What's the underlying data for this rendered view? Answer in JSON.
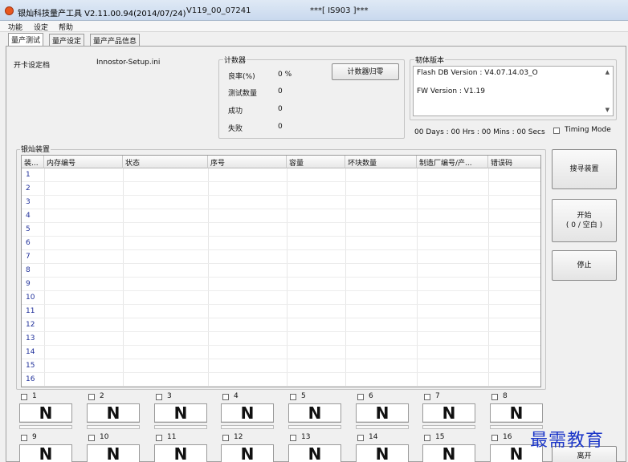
{
  "window": {
    "title": "银灿科技量产工具 V2.11.00.94(2014/07/24)",
    "version_code": "V119_00_07241",
    "model": "***[ IS903 ]***"
  },
  "menu": [
    "功能",
    "设定",
    "帮助"
  ],
  "tabs": [
    "量产测试",
    "量产设定",
    "量产产品信息"
  ],
  "settings_file": {
    "label": "开卡设定档",
    "value": "Innostor-Setup.ini"
  },
  "counter": {
    "title": "计数器",
    "yield_label": "良率(%)",
    "yield_value": "0 %",
    "tested_label": "测试数量",
    "tested_value": "0",
    "success_label": "成功",
    "success_value": "0",
    "fail_label": "失败",
    "fail_value": "0",
    "reset_button": "计数器归零"
  },
  "firmware": {
    "title": "韧体版本",
    "flash_db": "Flash DB Version :  V4.07.14.03_O",
    "fw": "FW Version :   V1.19"
  },
  "timer": "00 Days : 00 Hrs : 00 Mins : 00 Secs",
  "timing_mode_label": "Timing Mode",
  "device_group": {
    "title": "银灿装置",
    "columns": [
      "装...",
      "内存编号",
      "状态",
      "序号",
      "容量",
      "坏块数量",
      "制造厂编号/产...",
      "错误码"
    ],
    "rows": [
      "1",
      "2",
      "3",
      "4",
      "5",
      "6",
      "7",
      "8",
      "9",
      "10",
      "11",
      "12",
      "13",
      "14",
      "15",
      "16"
    ]
  },
  "buttons": {
    "search": "搜寻装置",
    "start_line1": "开始",
    "start_line2": "( 0 / 空白 )",
    "stop": "停止",
    "exit": "离开"
  },
  "slots": {
    "numbers_top": [
      "1",
      "2",
      "3",
      "4",
      "5",
      "6",
      "7",
      "8"
    ],
    "numbers_bottom": [
      "9",
      "10",
      "11",
      "12",
      "13",
      "14",
      "15",
      "16"
    ],
    "status_glyph": "N"
  },
  "watermark": "最需教育"
}
